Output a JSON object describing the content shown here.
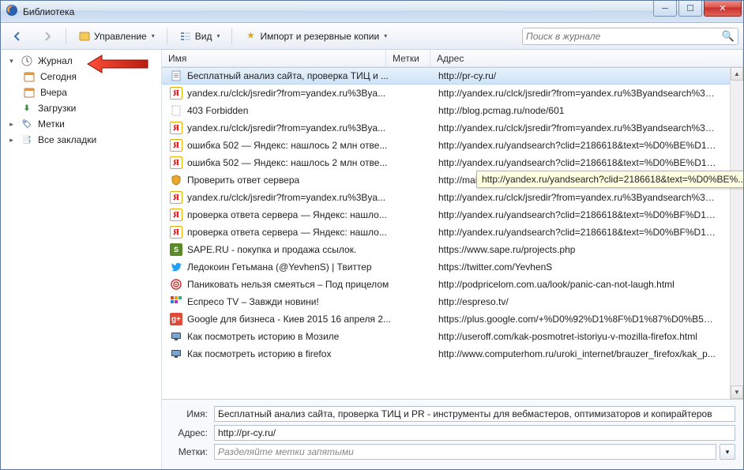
{
  "window": {
    "title": "Библиотека"
  },
  "toolbar": {
    "manage": "Управление",
    "view": "Вид",
    "import": "Импорт и резервные копии"
  },
  "search": {
    "placeholder": "Поиск в журнале"
  },
  "sidebar": {
    "history": "Журнал",
    "today": "Сегодня",
    "yesterday": "Вчера",
    "downloads": "Загрузки",
    "tags": "Метки",
    "bookmarks": "Все закладки"
  },
  "columns": {
    "name": "Имя",
    "tags": "Метки",
    "address": "Адрес"
  },
  "rows": [
    {
      "icon": "page",
      "name": "Бесплатный анализ сайта, проверка ТИЦ и ...",
      "addr": "http://pr-cy.ru/",
      "sel": true
    },
    {
      "icon": "yandex",
      "name": "yandex.ru/clck/jsredir?from=yandex.ru%3Bya...",
      "addr": "http://yandex.ru/clck/jsredir?from=yandex.ru%3Byandsearch%3Bw..."
    },
    {
      "icon": "blank",
      "name": "403 Forbidden",
      "addr": "http://blog.pcmag.ru/node/601"
    },
    {
      "icon": "yandex",
      "name": "yandex.ru/clck/jsredir?from=yandex.ru%3Bya...",
      "addr": "http://yandex.ru/clck/jsredir?from=yandex.ru%3Byandsearch%3Bw..."
    },
    {
      "icon": "yandex",
      "name": "ошибка 502 — Яндекс: нашлось 2 млн отве...",
      "addr": "http://yandex.ru/yandsearch?clid=2186618&text=%D0%BE%D1%8..."
    },
    {
      "icon": "yandex",
      "name": "ошибка 502 — Яндекс: нашлось 2 млн отве...",
      "addr": "http://yandex.ru/yandsearch?clid=2186618&text=%D0%BE%D1%8..."
    },
    {
      "icon": "shield",
      "name": "Проверить ответ сервера",
      "addr": "http://mainspy.ru/..."
    },
    {
      "icon": "yandex",
      "name": "yandex.ru/clck/jsredir?from=yandex.ru%3Bya...",
      "addr": "http://yandex.ru/clck/jsredir?from=yandex.ru%3Byandsearch%3Bw..."
    },
    {
      "icon": "yandex",
      "name": "проверка ответа сервера — Яндекс: нашло...",
      "addr": "http://yandex.ru/yandsearch?clid=2186618&text=%D0%BF%D1%8..."
    },
    {
      "icon": "yandex",
      "name": "проверка ответа сервера — Яндекс: нашло...",
      "addr": "http://yandex.ru/yandsearch?clid=2186618&text=%D0%BF%D1%8..."
    },
    {
      "icon": "sape",
      "name": "SAPE.RU - покупка и продажа ссылок.",
      "addr": "https://www.sape.ru/projects.php"
    },
    {
      "icon": "twitter",
      "name": "Ледокоин Гетьмана (@YevhenS) | Твиттер",
      "addr": "https://twitter.com/YevhenS"
    },
    {
      "icon": "target",
      "name": "Паниковать нельзя смеяться – Под прицелом",
      "addr": "http://podpricelom.com.ua/look/panic-can-not-laugh.html"
    },
    {
      "icon": "espreso",
      "name": "Еспресо TV – Завжди новини!",
      "addr": "http://espreso.tv/"
    },
    {
      "icon": "gplus",
      "name": "Google для бизнеса - Киев 2015 16 апреля 2...",
      "addr": "https://plus.google.com/+%D0%92%D1%8F%D1%87%D0%B5%D1..."
    },
    {
      "icon": "mon",
      "name": "Как посмотреть историю в Мозиле",
      "addr": "http://useroff.com/kak-posmotret-istoriyu-v-mozilla-firefox.html"
    },
    {
      "icon": "mon",
      "name": "Как посмотреть историю в firefox",
      "addr": "http://www.computerhom.ru/uroki_internet/brauzer_firefox/kak_p..."
    }
  ],
  "tooltip": "http://yandex.ru/yandsearch?clid=2186618&text=%D0%BE%...",
  "details": {
    "name_label": "Имя:",
    "name_value": "Бесплатный анализ сайта, проверка ТИЦ и PR - инструменты для вебмастеров, оптимизаторов и копирайтеров",
    "addr_label": "Адрес:",
    "addr_value": "http://pr-cy.ru/",
    "tags_label": "Метки:",
    "tags_placeholder": "Разделяйте метки запятыми"
  }
}
